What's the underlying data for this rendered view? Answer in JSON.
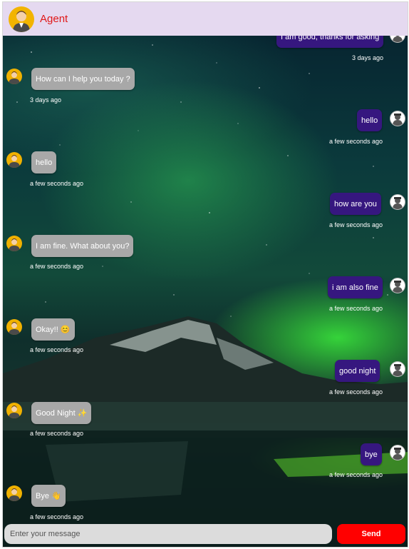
{
  "header": {
    "title": "Agent",
    "avatar_icon": "agent-avatar-icon"
  },
  "messages": [
    {
      "sender": "user",
      "text": "I am good, thanks for asking",
      "time": "3 days ago"
    },
    {
      "sender": "agent",
      "text": "How can I help you today ?",
      "time": "3 days ago"
    },
    {
      "sender": "user",
      "text": "hello",
      "time": "a few seconds ago"
    },
    {
      "sender": "agent",
      "text": "hello",
      "time": "a few seconds ago"
    },
    {
      "sender": "user",
      "text": "how are you",
      "time": "a few seconds ago"
    },
    {
      "sender": "agent",
      "text": "I am fine. What about you?",
      "time": "a few seconds ago"
    },
    {
      "sender": "user",
      "text": "i am also fine",
      "time": "a few seconds ago"
    },
    {
      "sender": "agent",
      "text": "Okay!! 😊",
      "time": "a few seconds ago"
    },
    {
      "sender": "user",
      "text": "good night",
      "time": "a few seconds ago"
    },
    {
      "sender": "agent",
      "text": "Good Night ✨",
      "time": "a few seconds ago"
    },
    {
      "sender": "user",
      "text": "bye",
      "time": "a few seconds ago"
    },
    {
      "sender": "agent",
      "text": "Bye 👋",
      "time": "a few seconds ago"
    }
  ],
  "composer": {
    "placeholder": "Enter your message",
    "send_label": "Send"
  },
  "colors": {
    "header_bg": "#e5d9f0",
    "title": "#e01818",
    "agent_bubble": "#a8a8a8",
    "user_bubble": "#36177f",
    "send_button": "#ff0000"
  }
}
